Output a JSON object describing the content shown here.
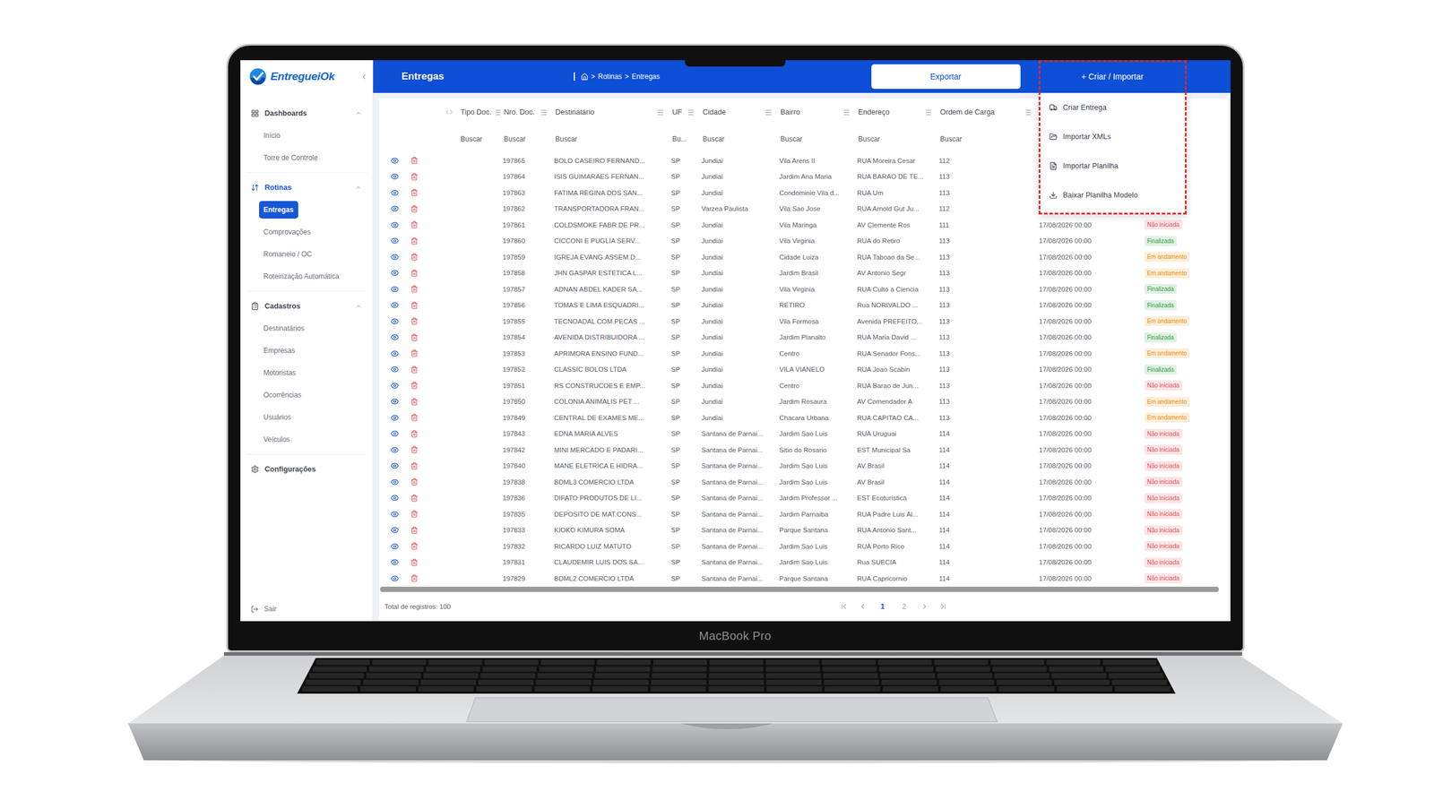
{
  "laptop": {
    "label": "MacBook Pro"
  },
  "logo": {
    "text": "EntregueiOk"
  },
  "sidebar": {
    "sections": [
      {
        "label": "Dashboards",
        "selected": false,
        "expanded": true,
        "items": [
          {
            "label": "Início",
            "selected": false
          },
          {
            "label": "Torre de Controle",
            "selected": false
          }
        ]
      },
      {
        "label": "Rotinas",
        "selected": true,
        "expanded": true,
        "items": [
          {
            "label": "Entregas",
            "selected": true
          },
          {
            "label": "Comprovações",
            "selected": false
          },
          {
            "label": "Romaneio / OC",
            "selected": false
          },
          {
            "label": "Roteirização Automática",
            "selected": false
          }
        ]
      },
      {
        "label": "Cadastros",
        "selected": false,
        "expanded": true,
        "items": [
          {
            "label": "Destinatários",
            "selected": false
          },
          {
            "label": "Empresas",
            "selected": false
          },
          {
            "label": "Motoristas",
            "selected": false
          },
          {
            "label": "Ocorrências",
            "selected": false
          },
          {
            "label": "Usuários",
            "selected": false
          },
          {
            "label": "Veículos",
            "selected": false
          }
        ]
      },
      {
        "label": "Configurações",
        "selected": false,
        "expanded": false,
        "items": []
      }
    ],
    "logout": "Sair"
  },
  "header": {
    "title": "Entregas",
    "breadcrumb": [
      "Rotinas",
      "Entregas"
    ],
    "breadcrumb_separator": ">",
    "export_button": "Exportar",
    "create_button": "+ Criar / Importar"
  },
  "menu": {
    "open": true,
    "items": [
      "Criar Entrega",
      "Importar XMLs",
      "Importar Planilha",
      "Baixar Planilha Modelo"
    ]
  },
  "table": {
    "columns": [
      {
        "label": "Tipo Doc.",
        "filter": "Buscar"
      },
      {
        "label": "Nro. Doc.",
        "filter": "Buscar"
      },
      {
        "label": "Destinatário",
        "filter": "Buscar"
      },
      {
        "label": "UF",
        "filter": "Bu..."
      },
      {
        "label": "Cidade",
        "filter": "Buscar"
      },
      {
        "label": "Bairro",
        "filter": "Buscar"
      },
      {
        "label": "Endereço",
        "filter": "Buscar"
      },
      {
        "label": "Ordem de Carga",
        "filter": "Buscar"
      }
    ],
    "rows": [
      {
        "number": "197865",
        "recipient": "BOLO CASEIRO FERNAND...",
        "uf": "SP",
        "city": "Jundiai",
        "district": "Vila Arens II",
        "address": "RUA Moreira Cesar",
        "load_order": "112",
        "date": "",
        "status": null
      },
      {
        "number": "197864",
        "recipient": "ISIS GUIMARAES FERNAN...",
        "uf": "SP",
        "city": "Jundiai",
        "district": "Jardim Ana Maria",
        "address": "RUA BARAO DE TE...",
        "load_order": "113",
        "date": "",
        "status": null
      },
      {
        "number": "197863",
        "recipient": "FATIMA REGINA DOS SAN...",
        "uf": "SP",
        "city": "Jundiai",
        "district": "Condominio Vila d...",
        "address": "RUA Um",
        "load_order": "113",
        "date": "",
        "status": null
      },
      {
        "number": "197862",
        "recipient": "TRANSPORTADORA FRAN...",
        "uf": "SP",
        "city": "Varzea Paulista",
        "district": "Vila Sao Jose",
        "address": "RUA Arnold Gut Ju...",
        "load_order": "112",
        "date": "",
        "status": null
      },
      {
        "number": "197861",
        "recipient": "COLDSMOKE FABR.DE PR...",
        "uf": "SP",
        "city": "Jundiai",
        "district": "Vila Maringa",
        "address": "AV Clemente Ros",
        "load_order": "111",
        "date": "17/08/2026 00:00",
        "status": {
          "label": "Não iniciada",
          "color": "#e0525a"
        }
      },
      {
        "number": "197860",
        "recipient": "CICCONI E PUGLIA SERV...",
        "uf": "SP",
        "city": "Jundiai",
        "district": "Vila Virginia",
        "address": "RUA do Retiro",
        "load_order": "113",
        "date": "17/08/2026 00:00",
        "status": {
          "label": "Finalizada",
          "color": "#2f9e44"
        }
      },
      {
        "number": "197859",
        "recipient": "IGREJA EVANG.ASSEM.D...",
        "uf": "SP",
        "city": "Jundiai",
        "district": "Cidade Luiza",
        "address": "RUA Taboao da Se...",
        "load_order": "113",
        "date": "17/08/2026 00:00",
        "status": {
          "label": "Em andamento",
          "color": "#e8900c"
        }
      },
      {
        "number": "197858",
        "recipient": "JHN GASPAR ESTETICA L...",
        "uf": "SP",
        "city": "Jundiai",
        "district": "Jardim Brasil",
        "address": "AV Antonio Segr",
        "load_order": "113",
        "date": "17/08/2026 00:00",
        "status": {
          "label": "Em andamento",
          "color": "#e8900c"
        }
      },
      {
        "number": "197857",
        "recipient": "ADNAN ABDEL KADER SA...",
        "uf": "SP",
        "city": "Jundiai",
        "district": "Vila Virginia",
        "address": "RUA Culto a Ciencia",
        "load_order": "113",
        "date": "17/08/2026 00:00",
        "status": {
          "label": "Finalizada",
          "color": "#2f9e44"
        }
      },
      {
        "number": "197856",
        "recipient": "TOMAS E LIMA ESQUADRI...",
        "uf": "SP",
        "city": "Jundiai",
        "district": "RETIRO",
        "address": "Rua NORIVALDO ...",
        "load_order": "113",
        "date": "17/08/2026 00:00",
        "status": {
          "label": "Finalizada",
          "color": "#2f9e44"
        }
      },
      {
        "number": "197855",
        "recipient": "TECNOADAL COM.PECAS ...",
        "uf": "SP",
        "city": "Jundiai",
        "district": "Vila Formosa",
        "address": "Avenida PREFEITO...",
        "load_order": "113",
        "date": "17/08/2026 00:00",
        "status": {
          "label": "Em andamento",
          "color": "#e8900c"
        }
      },
      {
        "number": "197854",
        "recipient": "AVENIDA DISTRIBUIDORA ...",
        "uf": "SP",
        "city": "Jundiai",
        "district": "Jardim Planalto",
        "address": "RUA Maria David ...",
        "load_order": "113",
        "date": "17/08/2026 00:00",
        "status": {
          "label": "Finalizada",
          "color": "#2f9e44"
        }
      },
      {
        "number": "197853",
        "recipient": "APRIMORA ENSINO FUND...",
        "uf": "SP",
        "city": "Jundiai",
        "district": "Centro",
        "address": "RUA Senador Fons...",
        "load_order": "113",
        "date": "17/08/2026 00:00",
        "status": {
          "label": "Em andamento",
          "color": "#e8900c"
        }
      },
      {
        "number": "197852",
        "recipient": "CLASSIC BOLOS LTDA",
        "uf": "SP",
        "city": "Jundiai",
        "district": "VILA VIANELO",
        "address": "RUA Joao Scabin",
        "load_order": "113",
        "date": "17/08/2026 00:00",
        "status": {
          "label": "Finalizada",
          "color": "#2f9e44"
        }
      },
      {
        "number": "197851",
        "recipient": "RS CONSTRUCOES E EMP...",
        "uf": "SP",
        "city": "Jundiai",
        "district": "Centro",
        "address": "RUA Barao de Jun...",
        "load_order": "113",
        "date": "17/08/2026 00:00",
        "status": {
          "label": "Não iniciada",
          "color": "#e0525a"
        }
      },
      {
        "number": "197850",
        "recipient": "COLONIA ANIMALIS PET ...",
        "uf": "SP",
        "city": "Jundiai",
        "district": "Jardim Rosaura",
        "address": "AV Comendador A",
        "load_order": "113",
        "date": "17/08/2026 00:00",
        "status": {
          "label": "Em andamento",
          "color": "#e8900c"
        }
      },
      {
        "number": "197849",
        "recipient": "CENTRAL DE EXAMES ME...",
        "uf": "SP",
        "city": "Jundiai",
        "district": "Chacara Urbana",
        "address": "RUA CAPITAO CA...",
        "load_order": "113",
        "date": "17/08/2026 00:00",
        "status": {
          "label": "Em andamento",
          "color": "#e8900c"
        }
      },
      {
        "number": "197843",
        "recipient": "EDNA MARIA ALVES",
        "uf": "SP",
        "city": "Santana de Parnai...",
        "district": "Jardim Sao Luis",
        "address": "RUA Uruguai",
        "load_order": "114",
        "date": "17/08/2026 00:00",
        "status": {
          "label": "Não iniciada",
          "color": "#e0525a"
        }
      },
      {
        "number": "197842",
        "recipient": "MINI MERCADO E PADARI...",
        "uf": "SP",
        "city": "Santana de Parnai...",
        "district": "Sitio do Rosario",
        "address": "EST Municipal Sa",
        "load_order": "114",
        "date": "17/08/2026 00:00",
        "status": {
          "label": "Não iniciada",
          "color": "#e0525a"
        }
      },
      {
        "number": "197840",
        "recipient": "MANE ELETRICA E HIDRA...",
        "uf": "SP",
        "city": "Santana de Parnai...",
        "district": "Jardim Sao Luis",
        "address": "AV Brasil",
        "load_order": "114",
        "date": "17/08/2026 00:00",
        "status": {
          "label": "Não iniciada",
          "color": "#e0525a"
        }
      },
      {
        "number": "197838",
        "recipient": "BDML3 COMERCIO LTDA",
        "uf": "SP",
        "city": "Santana de Parnai...",
        "district": "Jardim Sao Luis",
        "address": "AV Brasil",
        "load_order": "114",
        "date": "17/08/2026 00:00",
        "status": {
          "label": "Não iniciada",
          "color": "#e0525a"
        }
      },
      {
        "number": "197836",
        "recipient": "DIFATO PRODUTOS DE LI...",
        "uf": "SP",
        "city": "Santana de Parnai...",
        "district": "Jardim Professor ...",
        "address": "EST Ecoturistica",
        "load_order": "114",
        "date": "17/08/2026 00:00",
        "status": {
          "label": "Não iniciada",
          "color": "#e0525a"
        }
      },
      {
        "number": "197835",
        "recipient": "DEPOSITO DE MAT.CONS...",
        "uf": "SP",
        "city": "Santana de Parnai...",
        "district": "Jardim Parnaiba",
        "address": "RUA Padre Luis Al...",
        "load_order": "114",
        "date": "17/08/2026 00:00",
        "status": {
          "label": "Não iniciada",
          "color": "#e0525a"
        }
      },
      {
        "number": "197833",
        "recipient": "KIOKO KIMURA SOMA",
        "uf": "SP",
        "city": "Santana de Parnai...",
        "district": "Parque Santana",
        "address": "RUA Antonio Sant...",
        "load_order": "114",
        "date": "17/08/2026 00:00",
        "status": {
          "label": "Não iniciada",
          "color": "#e0525a"
        }
      },
      {
        "number": "197832",
        "recipient": "RICARDO LUIZ MATUTO",
        "uf": "SP",
        "city": "Santana de Parnai...",
        "district": "Jardim Sao Luis",
        "address": "RUA Porto Rico",
        "load_order": "114",
        "date": "17/08/2026 00:00",
        "status": {
          "label": "Não iniciada",
          "color": "#e0525a"
        }
      },
      {
        "number": "197831",
        "recipient": "CLAUDEMIR LUIS DOS SA...",
        "uf": "SP",
        "city": "Santana de Parnai...",
        "district": "Jardim Sao Luis",
        "address": "Rua SUECIA",
        "load_order": "114",
        "date": "17/08/2026 00:00",
        "status": {
          "label": "Não iniciada",
          "color": "#e0525a"
        }
      },
      {
        "number": "197829",
        "recipient": "BDML2 COMERCIO LTDA",
        "uf": "SP",
        "city": "Santana de Parnai...",
        "district": "Parque Santana",
        "address": "RUA Capricornio",
        "load_order": "114",
        "date": "17/08/2026 00:00",
        "status": {
          "label": "Não iniciada",
          "color": "#e0525a"
        }
      }
    ]
  },
  "footer": {
    "total": "Total de registros: 100",
    "pages": [
      {
        "label": "1",
        "selected": true
      },
      {
        "label": "2",
        "selected": false
      }
    ]
  }
}
